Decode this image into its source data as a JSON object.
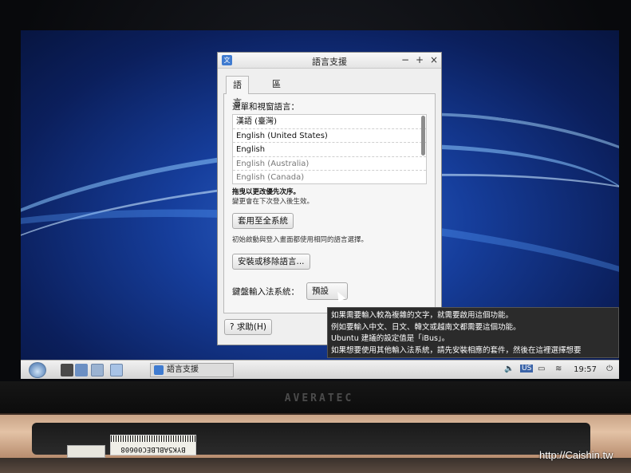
{
  "window": {
    "title": "語言支援",
    "controls": {
      "minimize": "−",
      "maximize": "+",
      "close": "×"
    }
  },
  "tabs": [
    "語言",
    "區域格式"
  ],
  "language_panel": {
    "heading": "選單和視窗語言：",
    "languages": [
      "漢語 (臺灣)",
      "English (United States)",
      "English",
      "English (Australia)",
      "English (Canada)"
    ],
    "drag_hint": "拖曳以更改優先次序。",
    "drag_hint2": "變更會在下次登入後生效。",
    "apply_system_button": "套用至全系統",
    "apply_hint": "初始啟動與登入畫面都使用相同的語言選擇。",
    "install_remove_button": "安裝或移除語言...",
    "ime_label": "鍵盤輸入法系統：",
    "ime_value": "預設",
    "help_button": "求助(H)"
  },
  "tooltip": {
    "lines": [
      "如果需要輸入較為複雜的文字，就需要啟用這個功能。",
      "例如要輸入中文、日文、韓文或越南文都需要這個功能。",
      "Ubuntu 建議的設定值是「iBus」。",
      "如果想要使用其他輸入法系統，請先安裝相應的套件，然後在這裡選擇想要"
    ]
  },
  "taskbar": {
    "active_task": "語言支援",
    "keyboard_layout": "US",
    "clock": "19:57"
  },
  "laptop": {
    "brand": "AVERATEC",
    "sticker": "BYK5ABLBEC00608"
  },
  "watermark": "http://Caishin.tw",
  "colors": {
    "desktop": "#163e9c",
    "tooltip_bg": "#2b2b2b",
    "window_bg": "#efefef"
  }
}
